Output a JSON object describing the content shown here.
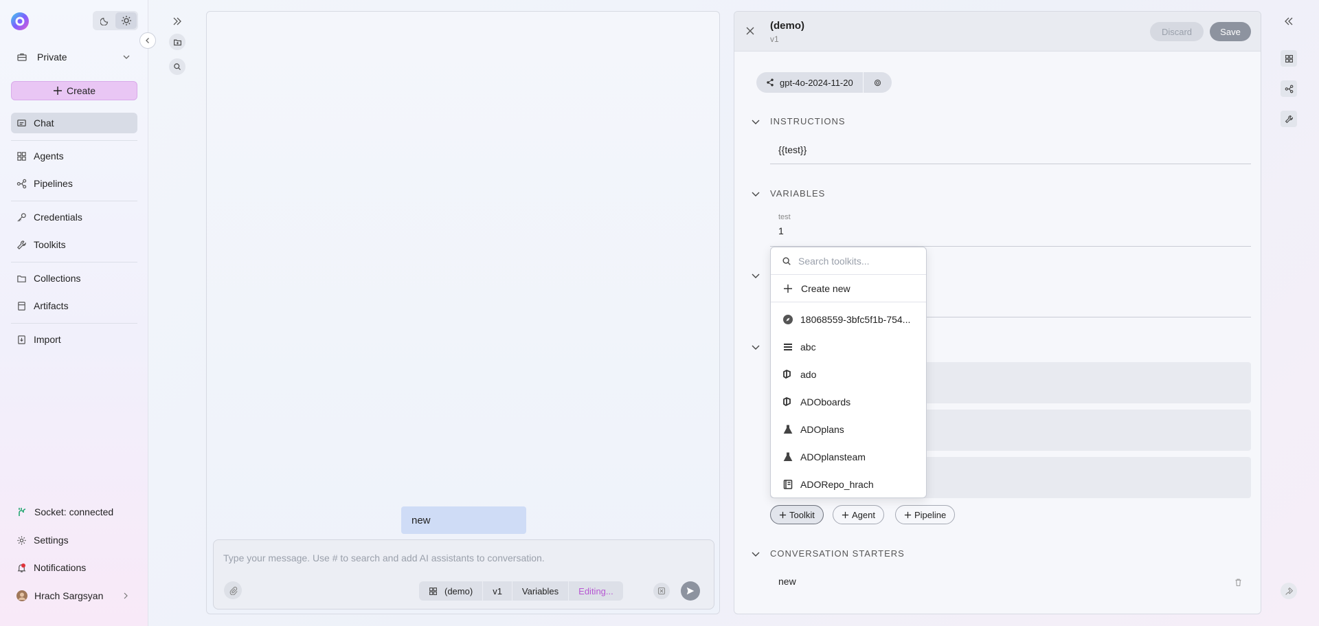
{
  "sidebar": {
    "workspace": "Private",
    "create_label": "Create",
    "nav": [
      {
        "label": "Chat",
        "icon": "chat-icon"
      },
      {
        "label": "Agents",
        "icon": "grid-icon"
      },
      {
        "label": "Pipelines",
        "icon": "pipeline-icon"
      },
      {
        "label": "Credentials",
        "icon": "key-icon"
      },
      {
        "label": "Toolkits",
        "icon": "wrench-icon"
      },
      {
        "label": "Collections",
        "icon": "folder-icon"
      },
      {
        "label": "Artifacts",
        "icon": "artifact-icon"
      },
      {
        "label": "Import",
        "icon": "import-icon"
      }
    ],
    "socket_status": "Socket: connected",
    "settings_label": "Settings",
    "notifications_label": "Notifications",
    "user_name": "Hrach Sargsyan",
    "accent_color": "#e9c6f4"
  },
  "chat": {
    "message": "new",
    "placeholder": "Type your message. Use # to search and add AI assistants to conversation.",
    "chips": {
      "agent": "(demo)",
      "version": "v1",
      "variables": "Variables",
      "status": "Editing..."
    }
  },
  "editor": {
    "title": "(demo)",
    "version": "v1",
    "discard_label": "Discard",
    "save_label": "Save",
    "model": "gpt-4o-2024-11-20",
    "sections": {
      "instructions": "INSTRUCTIONS",
      "variables": "VARIABLES",
      "conversation_starters": "CONVERSATION STARTERS"
    },
    "instructions_value": "{{test}}",
    "variable": {
      "name": "test",
      "value": "1"
    },
    "add_buttons": {
      "toolkit": "Toolkit",
      "agent": "Agent",
      "pipeline": "Pipeline"
    },
    "starter": "new"
  },
  "toolkit_dropdown": {
    "search_placeholder": "Search toolkits...",
    "create_label": "Create new",
    "items": [
      {
        "label": "18068559-3bfc5f1b-754...",
        "icon": "compass-icon"
      },
      {
        "label": "abc",
        "icon": "list-icon"
      },
      {
        "label": "ado",
        "icon": "azure-devops-icon"
      },
      {
        "label": "ADOboards",
        "icon": "azure-devops-icon"
      },
      {
        "label": "ADOplans",
        "icon": "flask-icon"
      },
      {
        "label": "ADOplansteam",
        "icon": "flask-icon"
      },
      {
        "label": "ADORepo_hrach",
        "icon": "repo-icon"
      }
    ]
  }
}
